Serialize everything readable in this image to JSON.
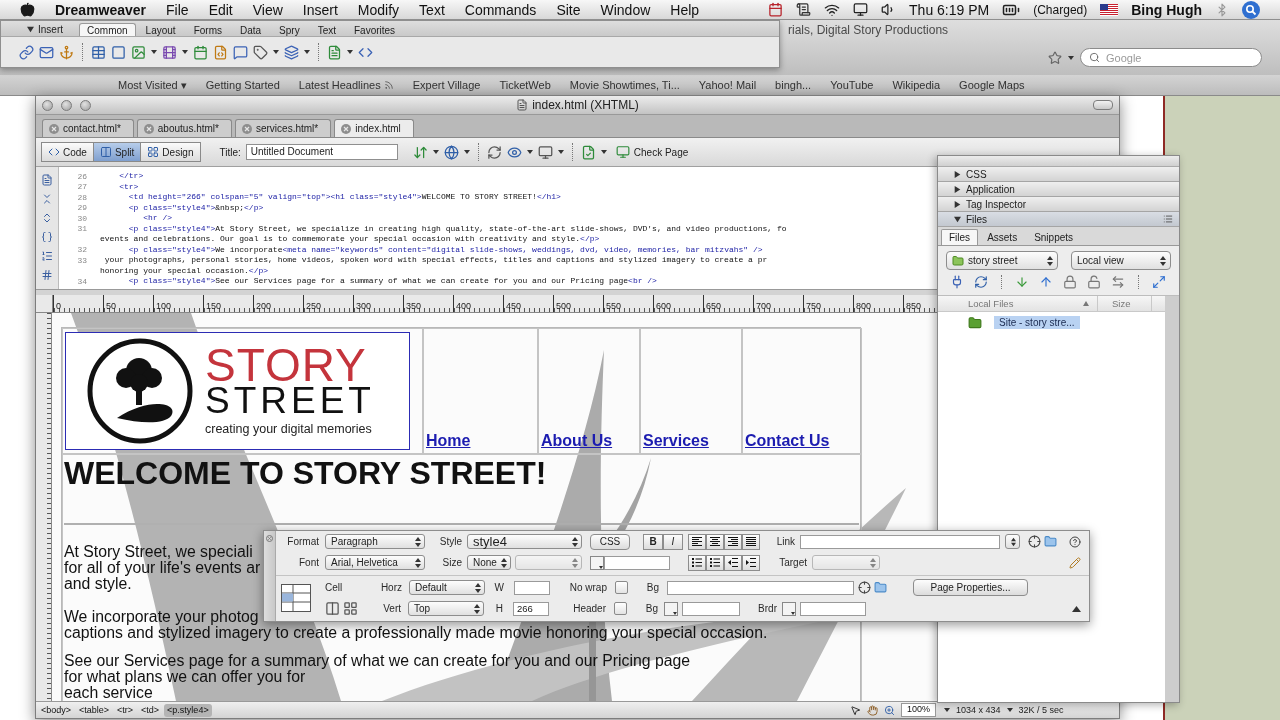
{
  "menu_bar": {
    "app_name": "Dreamweaver",
    "menus": [
      "File",
      "Edit",
      "View",
      "Insert",
      "Modify",
      "Text",
      "Commands",
      "Site",
      "Window",
      "Help"
    ],
    "clock": "Thu 6:19 PM",
    "battery": "(Charged)",
    "user": "Bing Hugh"
  },
  "browser": {
    "title": "rials, Digital Story Productions",
    "search": {
      "placeholder": "Google"
    },
    "bookmarks": [
      {
        "label": "Most Visited ▾",
        "kind": "link"
      },
      {
        "label": "Getting Started",
        "kind": "link"
      },
      {
        "label": "Latest Headlines",
        "kind": "feed"
      },
      {
        "label": "Expert Village",
        "kind": "link"
      },
      {
        "label": "TicketWeb",
        "kind": "link"
      },
      {
        "label": "Movie Showtimes, Ti...",
        "kind": "link"
      },
      {
        "label": "Yahoo! Mail",
        "kind": "link"
      },
      {
        "label": "bingh...",
        "kind": "link"
      },
      {
        "label": "YouTube",
        "kind": "link"
      },
      {
        "label": "Wikipedia",
        "kind": "link"
      },
      {
        "label": "Google Maps",
        "kind": "link"
      }
    ]
  },
  "insert_bar": {
    "title": "Insert",
    "expanded": true,
    "tabs": [
      {
        "label": "Common",
        "selected": true
      },
      {
        "label": "Layout",
        "selected": false
      },
      {
        "label": "Forms",
        "selected": false
      },
      {
        "label": "Data",
        "selected": false
      },
      {
        "label": "Spry",
        "selected": false
      },
      {
        "label": "Text",
        "selected": false
      },
      {
        "label": "Favorites",
        "selected": false
      }
    ]
  },
  "document": {
    "title": "index.html (XHTML)",
    "tabs": [
      {
        "label": "contact.html*",
        "selected": false
      },
      {
        "label": "aboutus.html*",
        "selected": false
      },
      {
        "label": "services.html*",
        "selected": false
      },
      {
        "label": "index.html",
        "selected": true
      }
    ],
    "views": [
      {
        "label": "Code",
        "selected": false
      },
      {
        "label": "Split",
        "selected": true
      },
      {
        "label": "Design",
        "selected": false
      }
    ],
    "title_field": {
      "label": "Title:",
      "value": "Untitled Document"
    },
    "check_page": "Check Page",
    "code_lines": [
      {
        "number": "26",
        "text": "    </tr>"
      },
      {
        "number": "27",
        "text": "    <tr>"
      },
      {
        "number": "28",
        "text": "      <td height=\"266\" colspan=\"5\" valign=\"top\"><h1 class=\"style4\">WELCOME TO STORY STREET!</h1>"
      },
      {
        "number": "29",
        "text": "      <p class=\"style4\">&nbsp;</p>"
      },
      {
        "number": "30",
        "text": "         <hr />"
      },
      {
        "number": "31",
        "text": "      <p class=\"style4\">At Story Street, we specialize in creating high quality, state-of-the-art slide-shows, DVD's, and video productions, fo"
      },
      {
        "text": "events and celebrations. Our goal is to commemorate your special occasion with creativity and style.</p>"
      },
      {
        "number": "32",
        "text": "      <p class=\"style4\">We incorporate<meta name=\"keywords\" content=\"digital slide-shows, weddings, dvd, video, memories, bar mitzvahs\" />"
      },
      {
        "number": "33",
        "text": " your photographs, personal stories, home videos, spoken word with special effects, titles and captions and stylized imagery to create a pr"
      },
      {
        "text": "honoring your special occasion.</p>"
      },
      {
        "number": "34",
        "text": "      <p class=\"style4\">See our Services page for a summary of what we can create for you and our Pricing page<br />"
      }
    ],
    "ruler": [
      "0",
      "50",
      "100",
      "150",
      "200",
      "250",
      "300",
      "350",
      "400",
      "450",
      "500",
      "550",
      "600",
      "650",
      "700",
      "750",
      "800",
      "850"
    ],
    "page": {
      "logo": {
        "top": "STORY",
        "bottom": "STREET",
        "tagline": "creating your digital memories"
      },
      "nav_links": [
        "Home",
        "About Us",
        "Services",
        "Contact Us"
      ],
      "heading": "WELCOME TO STORY STREET!",
      "paragraphs": [
        {
          "lines": [
            "At Story Street, we speciali",
            "for all of your life's events ar",
            "and style."
          ]
        },
        {
          "lines": [
            "We incorporate your photog",
            "captions and stylized imagery to create a professionally made movie honoring your special occasion."
          ]
        },
        {
          "lines": [
            "See our Services page for a summary of what we can create for you and our Pricing page",
            "for what plans we can offer you for",
            "each service"
          ]
        }
      ]
    },
    "tag_selector": [
      {
        "label": "<body>",
        "selected": false
      },
      {
        "label": "<table>",
        "selected": false
      },
      {
        "label": "<tr>",
        "selected": false
      },
      {
        "label": "<td>",
        "selected": false
      },
      {
        "label": "<p.style4>",
        "selected": true
      }
    ],
    "zoom": "100%",
    "window_size": "1034 x 434",
    "download_time": "32K / 5 sec"
  },
  "panel_group": [
    {
      "label": "CSS",
      "expanded": false
    },
    {
      "label": "Application",
      "expanded": false
    },
    {
      "label": "Tag Inspector",
      "expanded": false
    },
    {
      "label": "Files",
      "expanded": true
    }
  ],
  "files_panel": {
    "tabs": [
      {
        "label": "Files",
        "selected": true
      },
      {
        "label": "Assets",
        "selected": false
      },
      {
        "label": "Snippets",
        "selected": false
      }
    ],
    "site": "story street",
    "view": "Local view",
    "columns": [
      "Local Files",
      "Size"
    ],
    "rows": [
      {
        "name": "Site - story stre...",
        "selected": true
      }
    ]
  },
  "property_inspector": {
    "format": {
      "label": "Format",
      "value": "Paragraph"
    },
    "style": {
      "label": "Style",
      "value": "style4"
    },
    "css_button": "CSS",
    "bold_button": "B",
    "italic_button": "I",
    "link": {
      "label": "Link"
    },
    "font": {
      "label": "Font",
      "value": "Arial, Helvetica"
    },
    "size": {
      "label": "Size",
      "value": "None"
    },
    "target": {
      "label": "Target"
    },
    "cell_label": "Cell",
    "horz": {
      "label": "Horz",
      "value": "Default"
    },
    "width": {
      "label": "W"
    },
    "no_wrap": {
      "label": "No wrap",
      "checked": false
    },
    "bg_image": {
      "label": "Bg"
    },
    "page_properties": "Page Properties...",
    "vert": {
      "label": "Vert",
      "value": "Top"
    },
    "height": {
      "label": "H",
      "value": "266"
    },
    "header": {
      "label": "Header",
      "checked": false
    },
    "bg_color": {
      "label": "Bg"
    },
    "border": {
      "label": "Brdr"
    }
  }
}
